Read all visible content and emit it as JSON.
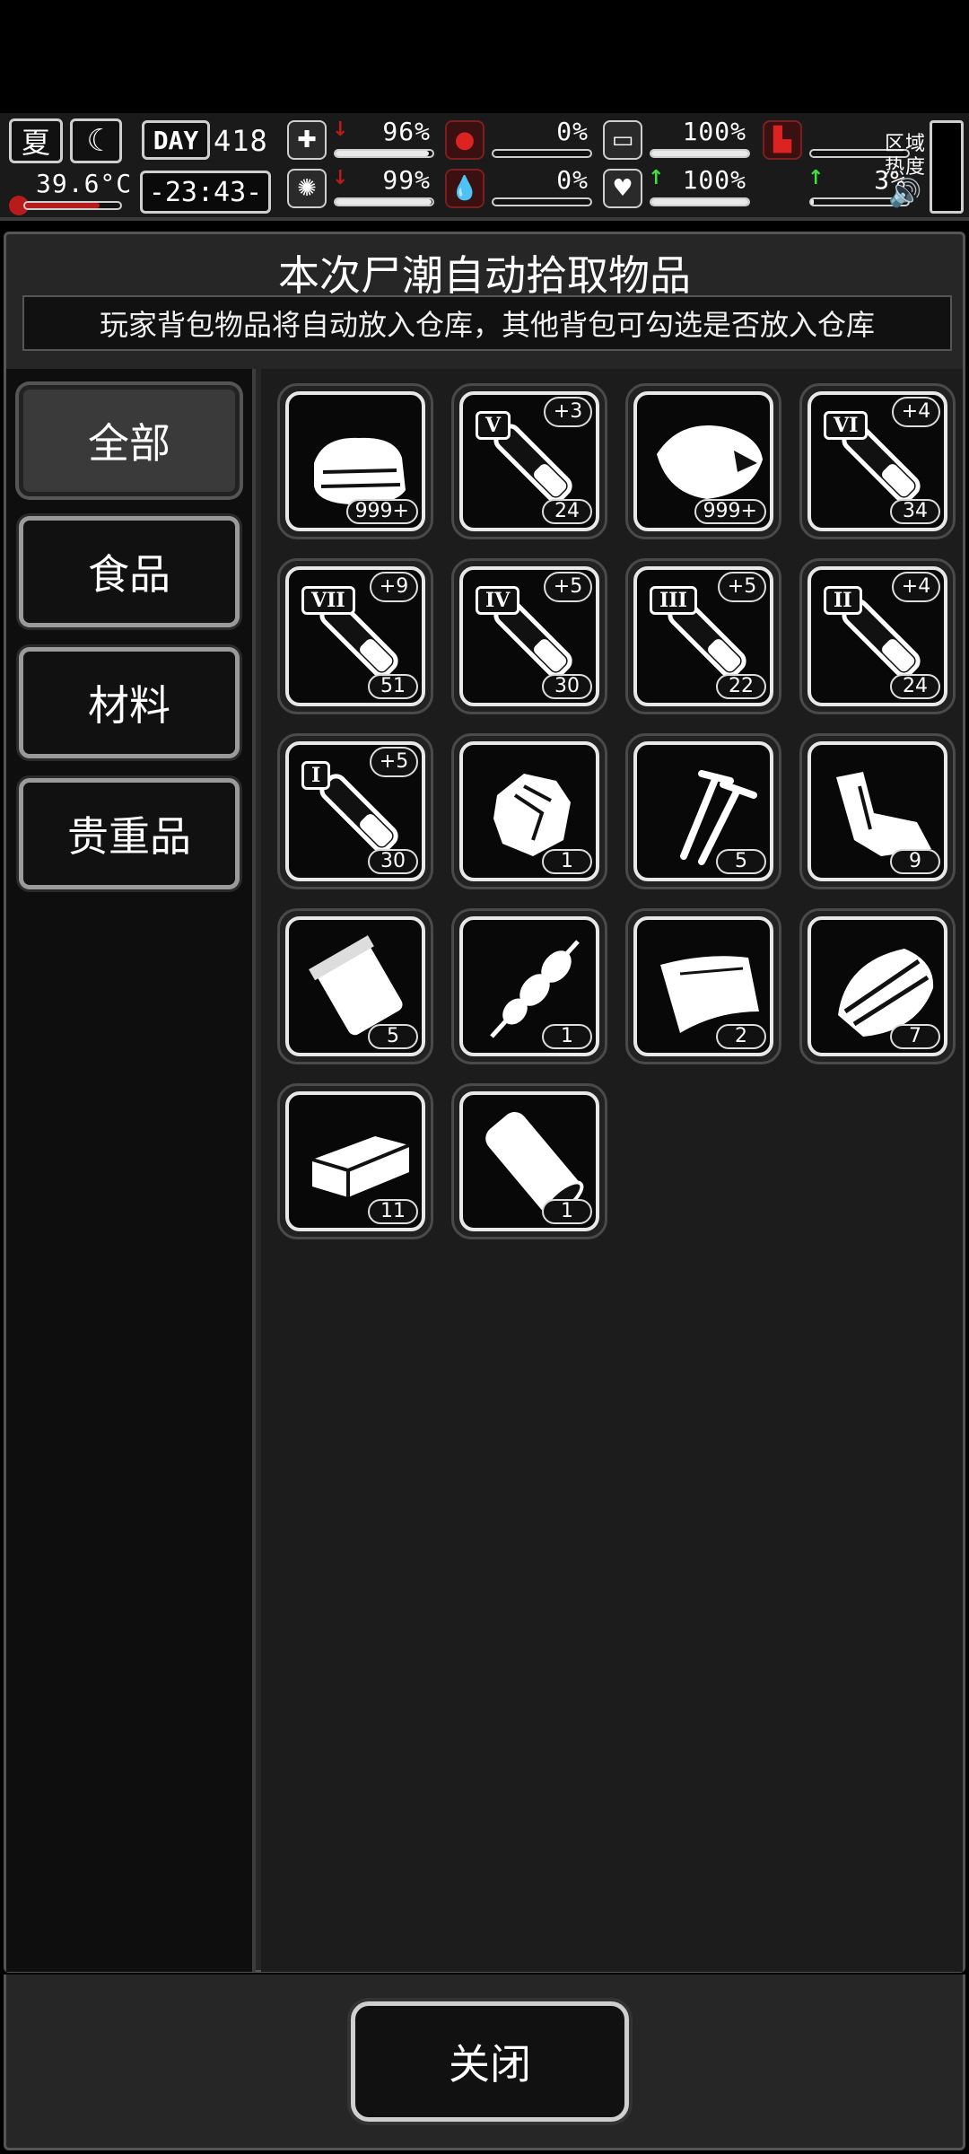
{
  "hud": {
    "season": "夏",
    "temperature": "39.6°C",
    "temperature_level": 0.78,
    "day_label": "DAY",
    "day_number": "418",
    "clock": "-23:43-",
    "stats": [
      {
        "icon": "medkit-icon",
        "trend": "down",
        "value": "96%",
        "level": 0.96
      },
      {
        "icon": "stomach-icon",
        "trend": "",
        "value": "0%",
        "level": 0.0
      },
      {
        "icon": "pill-icon",
        "trend": "",
        "value": "100%",
        "level": 1.0
      },
      {
        "icon": "boot-icon",
        "trend": "",
        "value": "",
        "level": 0.0
      },
      {
        "icon": "brain-icon",
        "trend": "down",
        "value": "99%",
        "level": 0.99
      },
      {
        "icon": "blood-drop-icon",
        "trend": "",
        "value": "0%",
        "level": 0.0
      },
      {
        "icon": "heart-icon",
        "trend": "up",
        "value": "100%",
        "level": 1.0
      },
      {
        "icon": "",
        "trend": "up",
        "value": "3%",
        "level": 0.03
      }
    ],
    "zone_heat_label_1": "区域",
    "zone_heat_label_2": "热度",
    "colors": {
      "red": "#b81b1b",
      "green": "#3ee23e",
      "accent": "#e8e8e8"
    }
  },
  "panel": {
    "title": "本次尸潮自动拾取物品",
    "subtitle": "玩家背包物品将自动放入仓库，其他背包可勾选是否放入仓库"
  },
  "tabs": [
    {
      "label": "全部",
      "active": true
    },
    {
      "label": "食品",
      "active": false
    },
    {
      "label": "材料",
      "active": false
    },
    {
      "label": "贵重品",
      "active": false
    }
  ],
  "items": [
    {
      "icon": "cloth-icon",
      "count": "999+",
      "roman": "",
      "plus": ""
    },
    {
      "icon": "syringe-icon",
      "count": "24",
      "roman": "V",
      "plus": "+3"
    },
    {
      "icon": "meat-icon",
      "count": "999+",
      "roman": "",
      "plus": ""
    },
    {
      "icon": "syringe-icon",
      "count": "34",
      "roman": "VI",
      "plus": "+4"
    },
    {
      "icon": "syringe-icon",
      "count": "51",
      "roman": "VII",
      "plus": "+9"
    },
    {
      "icon": "syringe-icon",
      "count": "30",
      "roman": "IV",
      "plus": "+5"
    },
    {
      "icon": "syringe-icon",
      "count": "22",
      "roman": "III",
      "plus": "+5"
    },
    {
      "icon": "syringe-icon",
      "count": "24",
      "roman": "II",
      "plus": "+4"
    },
    {
      "icon": "syringe-icon",
      "count": "30",
      "roman": "I",
      "plus": "+5"
    },
    {
      "icon": "crumpled-paper-icon",
      "count": "1",
      "roman": "",
      "plus": ""
    },
    {
      "icon": "nails-icon",
      "count": "5",
      "roman": "",
      "plus": ""
    },
    {
      "icon": "scrap-pipe-icon",
      "count": "9",
      "roman": "",
      "plus": ""
    },
    {
      "icon": "food-bag-icon",
      "count": "5",
      "roman": "",
      "plus": ""
    },
    {
      "icon": "skewer-icon",
      "count": "1",
      "roman": "",
      "plus": ""
    },
    {
      "icon": "leather-icon",
      "count": "2",
      "roman": "",
      "plus": ""
    },
    {
      "icon": "planks-icon",
      "count": "7",
      "roman": "",
      "plus": ""
    },
    {
      "icon": "brick-icon",
      "count": "11",
      "roman": "",
      "plus": ""
    },
    {
      "icon": "log-icon",
      "count": "1",
      "roman": "",
      "plus": ""
    }
  ],
  "close_label": "关闭"
}
